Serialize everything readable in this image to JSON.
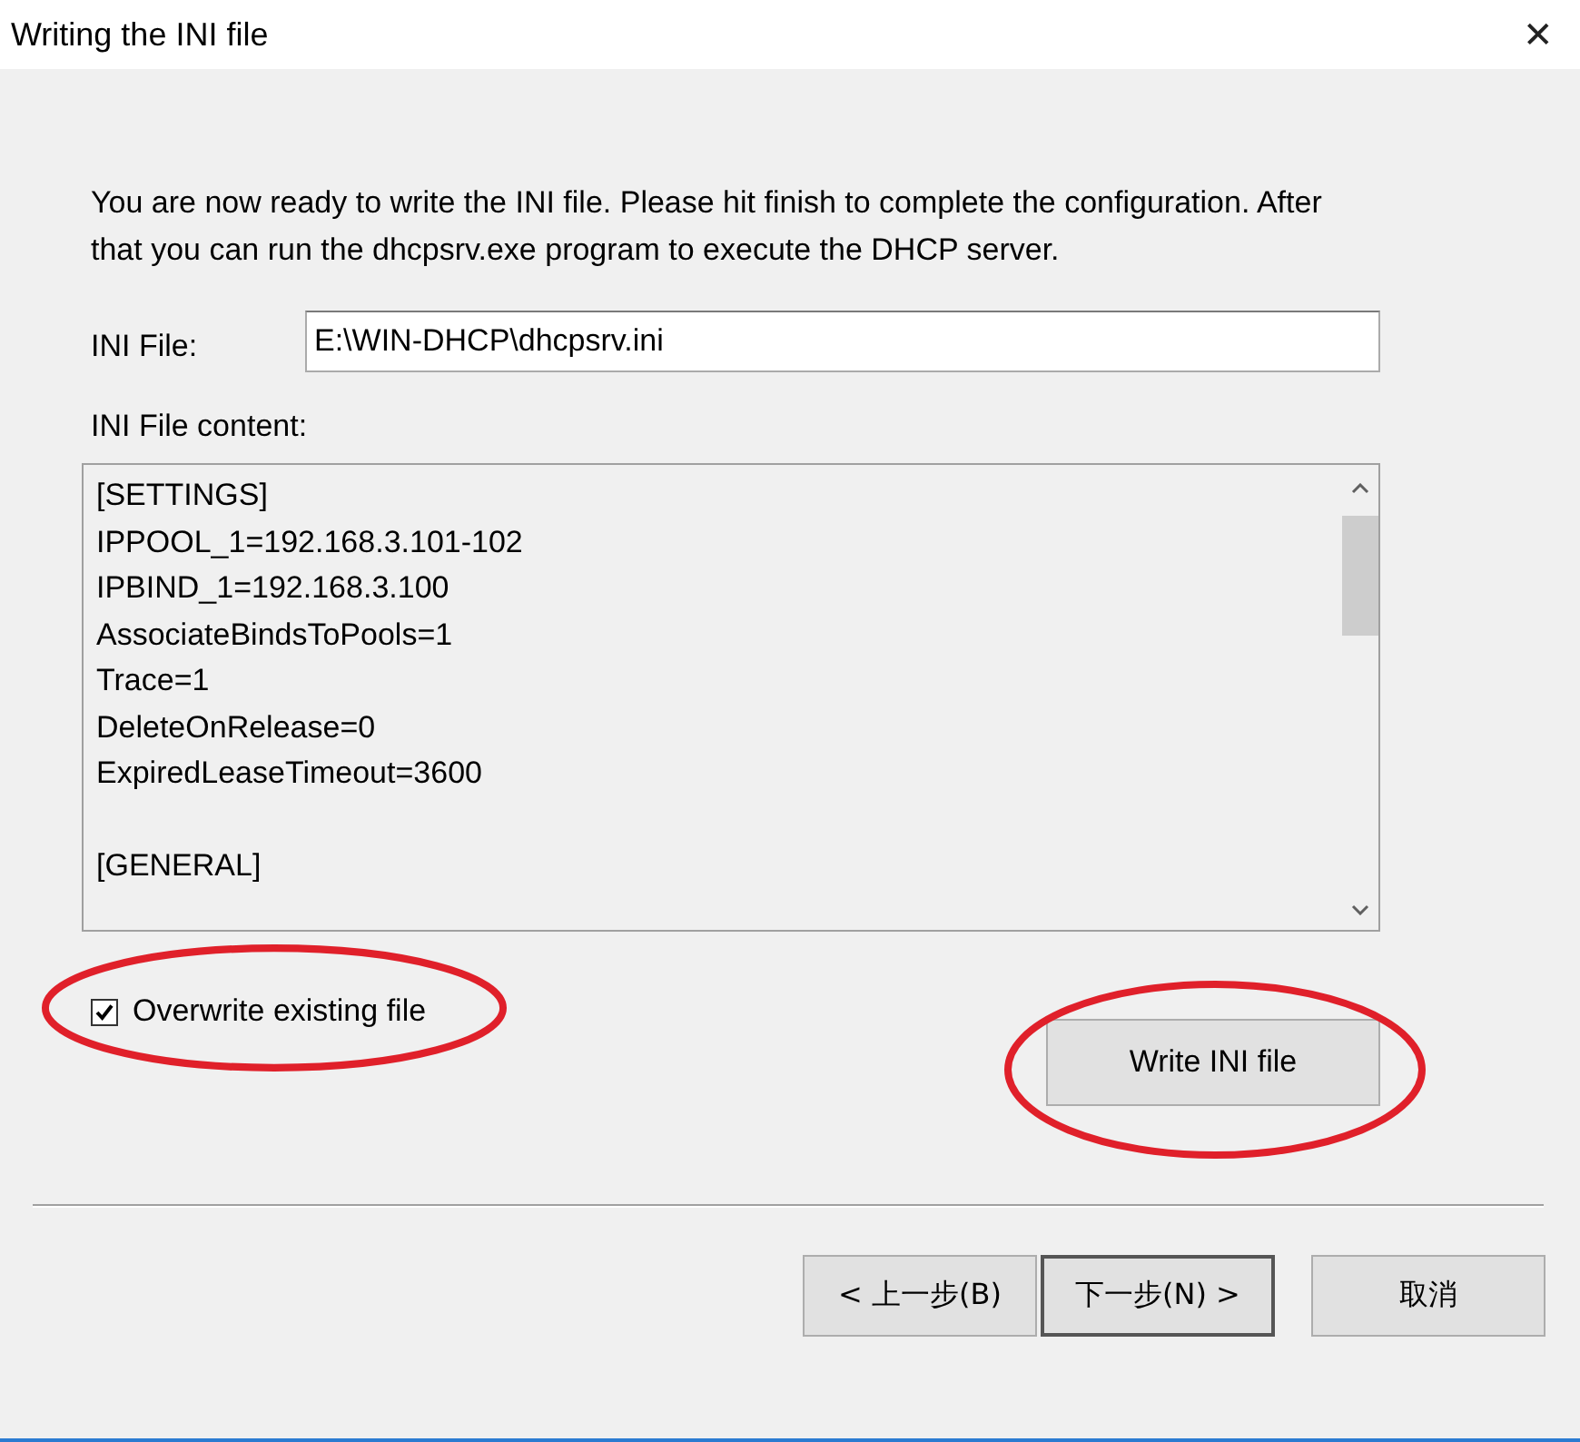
{
  "window": {
    "title": "Writing the INI file",
    "close": "✕"
  },
  "intro": "You are now ready to write the INI file. Please hit finish to complete the configuration. After that you can run the dhcpsrv.exe program to execute the DHCP server.",
  "ini_file": {
    "label": "INI File:",
    "value": "E:\\WIN-DHCP\\dhcpsrv.ini"
  },
  "content": {
    "label": "INI File content:",
    "sections": [
      {
        "header": "[SETTINGS]",
        "entries": [
          "IPPOOL_1=192.168.3.101-102",
          "IPBIND_1=192.168.3.100",
          "AssociateBindsToPools=1",
          "Trace=1",
          "DeleteOnRelease=0",
          "ExpiredLeaseTimeout=3600"
        ]
      },
      {
        "header": "[GENERAL]"
      }
    ]
  },
  "overwrite": {
    "label": "Overwrite existing file",
    "checked": true
  },
  "write_button": "Write INI file",
  "buttons": [
    {
      "label": "< 上一步(B)",
      "default": false
    },
    {
      "label": "下一步(N) >",
      "default": true
    },
    {
      "label": "取消",
      "default": false
    }
  ]
}
